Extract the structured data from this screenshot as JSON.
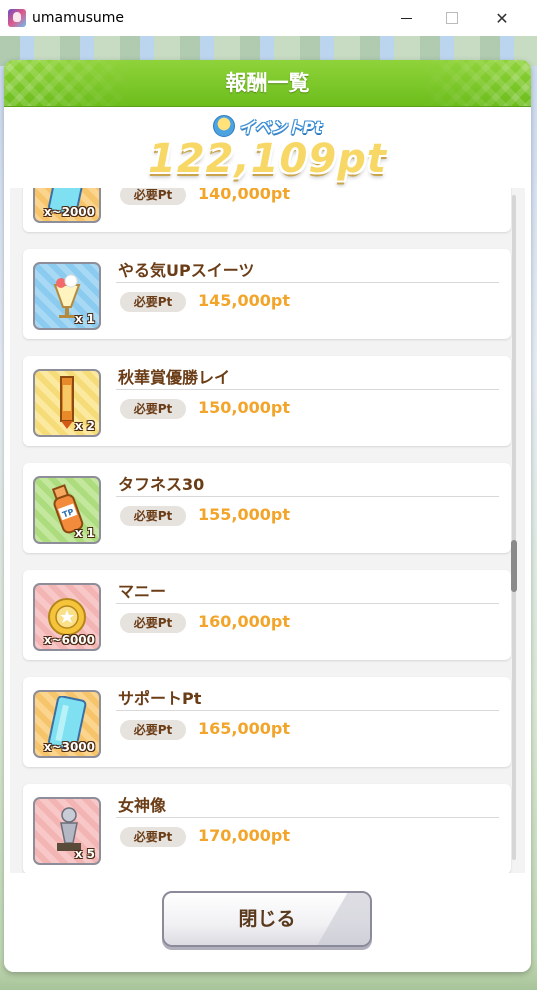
{
  "window": {
    "title": "umamusume",
    "min_label": "",
    "close_label": "✕"
  },
  "dialog": {
    "title": "報酬一覧",
    "points_label": "イベントPt",
    "points_value": "122,109pt",
    "close_button_label": "閉じる"
  },
  "rewards": [
    {
      "name": "",
      "qty": "x~2000",
      "req_label": "必要Pt",
      "req_value": "140,000pt",
      "icon": "support-pt-card-icon",
      "color": "#fbd58e"
    },
    {
      "name": "やる気UPスイーツ",
      "qty": "x 1",
      "req_label": "必要Pt",
      "req_value": "145,000pt",
      "icon": "parfait-icon",
      "color": "#a7d8f4"
    },
    {
      "name": "秋華賞優勝レイ",
      "qty": "x 2",
      "req_label": "必要Pt",
      "req_value": "150,000pt",
      "icon": "winner-lei-icon",
      "color": "#fbe9a0"
    },
    {
      "name": "タフネス30",
      "qty": "x 1",
      "req_label": "必要Pt",
      "req_value": "155,000pt",
      "icon": "tp-drink-icon",
      "color": "#c4e79e"
    },
    {
      "name": "マニー",
      "qty": "x~6000",
      "req_label": "必要Pt",
      "req_value": "160,000pt",
      "icon": "money-coin-icon",
      "color": "#f8c8c8"
    },
    {
      "name": "サポートPt",
      "qty": "x~3000",
      "req_label": "必要Pt",
      "req_value": "165,000pt",
      "icon": "support-pt-card-icon",
      "color": "#fbd58e"
    },
    {
      "name": "女神像",
      "qty": "x 5",
      "req_label": "必要Pt",
      "req_value": "170,000pt",
      "icon": "goddess-statue-icon",
      "color": "#f8c8c8"
    }
  ]
}
